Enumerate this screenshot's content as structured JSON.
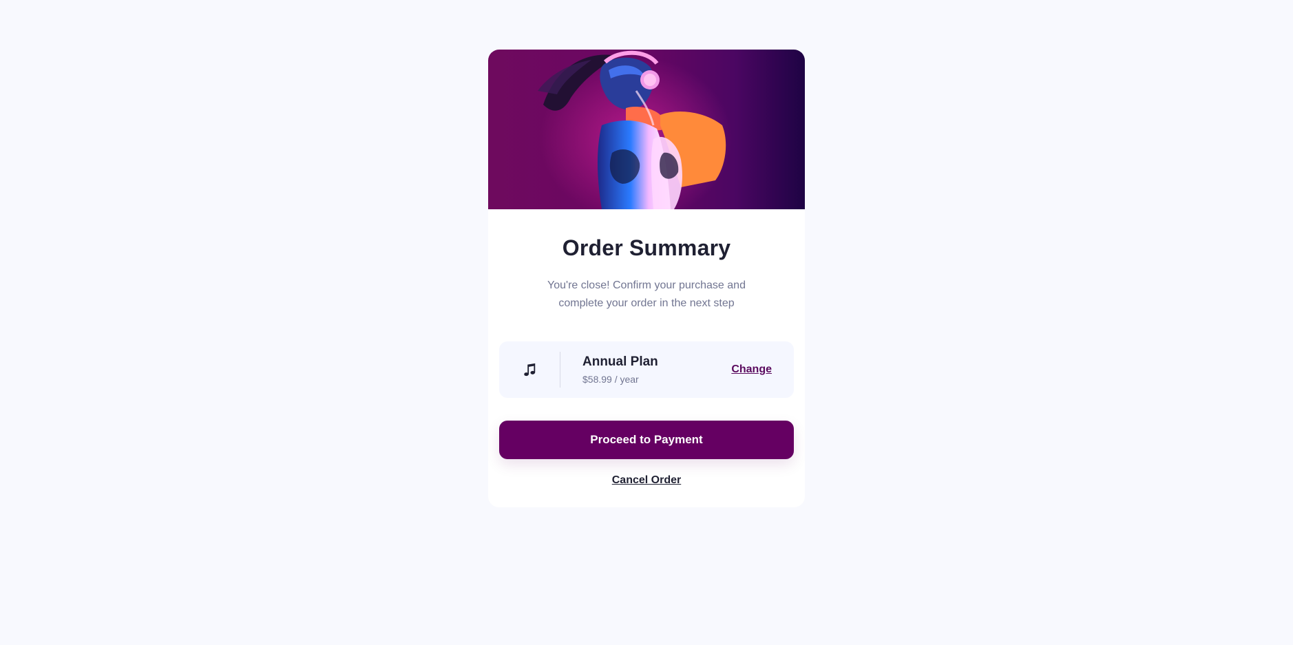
{
  "order": {
    "title": "Order Summary",
    "subtitle": "You're close! Confirm your purchase and complete your order in the next step",
    "hero_image": "person-with-headphones-neon-illustration",
    "plan": {
      "icon": "music-note-icon",
      "name": "Annual Plan",
      "price": "$58.99 / year",
      "change_label": "Change"
    },
    "primary_action": "Proceed to Payment",
    "secondary_action": "Cancel Order"
  },
  "colors": {
    "page_background": "#f8f9fe",
    "card_background": "#ffffff",
    "primary": "#650062",
    "heading": "#1f2032",
    "muted": "#717591",
    "plan_background": "#f5f7ff"
  }
}
